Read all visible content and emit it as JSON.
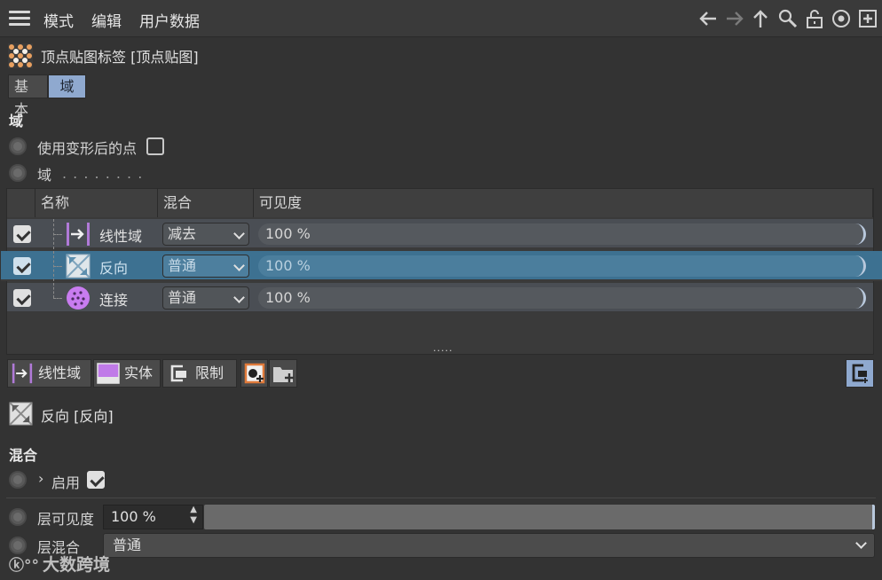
{
  "menubar": {
    "items": [
      "模式",
      "编辑",
      "用户数据"
    ]
  },
  "toolbar_icons": [
    "back-arrow-icon",
    "forward-arrow-icon",
    "up-arrow-icon",
    "search-icon",
    "lock-icon",
    "target-icon",
    "new-panel-icon"
  ],
  "object": {
    "title": "顶点贴图标签 [顶点贴图]"
  },
  "tabs": [
    {
      "label": "基本",
      "active": false
    },
    {
      "label": "域",
      "active": true
    }
  ],
  "field_section": {
    "heading": "域",
    "use_deformed_label": "使用变形后的点",
    "use_deformed_checked": false,
    "field_label": "域",
    "field_dots": ". . . . . . . ."
  },
  "field_list": {
    "columns": [
      "名称",
      "混合",
      "可见度"
    ],
    "rows": [
      {
        "name": "线性域",
        "blend": "减去",
        "visibility": "100 %",
        "enabled": true,
        "selected": false,
        "icon": "linear-field-icon"
      },
      {
        "name": "反向",
        "blend": "普通",
        "visibility": "100 %",
        "enabled": true,
        "selected": true,
        "icon": "invert-icon"
      },
      {
        "name": "连接",
        "blend": "普通",
        "visibility": "100 %",
        "enabled": true,
        "selected": false,
        "icon": "connect-icon"
      }
    ],
    "resize_grip": "....."
  },
  "add_toolbar": {
    "linear_label": "线性域",
    "solid_label": "实体",
    "limit_label": "限制"
  },
  "selected_layer": {
    "title": "反向 [反向]"
  },
  "blend_section": {
    "heading": "混合",
    "enable_label": "启用",
    "enable_checked": true,
    "layer_visibility_label": "层可见度",
    "layer_visibility_value": "100 %",
    "layer_visibility_fraction": 1.0,
    "layer_blend_label": "层混合",
    "layer_blend_value": "普通"
  },
  "watermark": "大数跨境",
  "colors": {
    "selection": "#3d7191",
    "tab_active": "#8fa9cf",
    "linear_icon": "#b07ad8",
    "connect_icon": "#c87cf0"
  }
}
